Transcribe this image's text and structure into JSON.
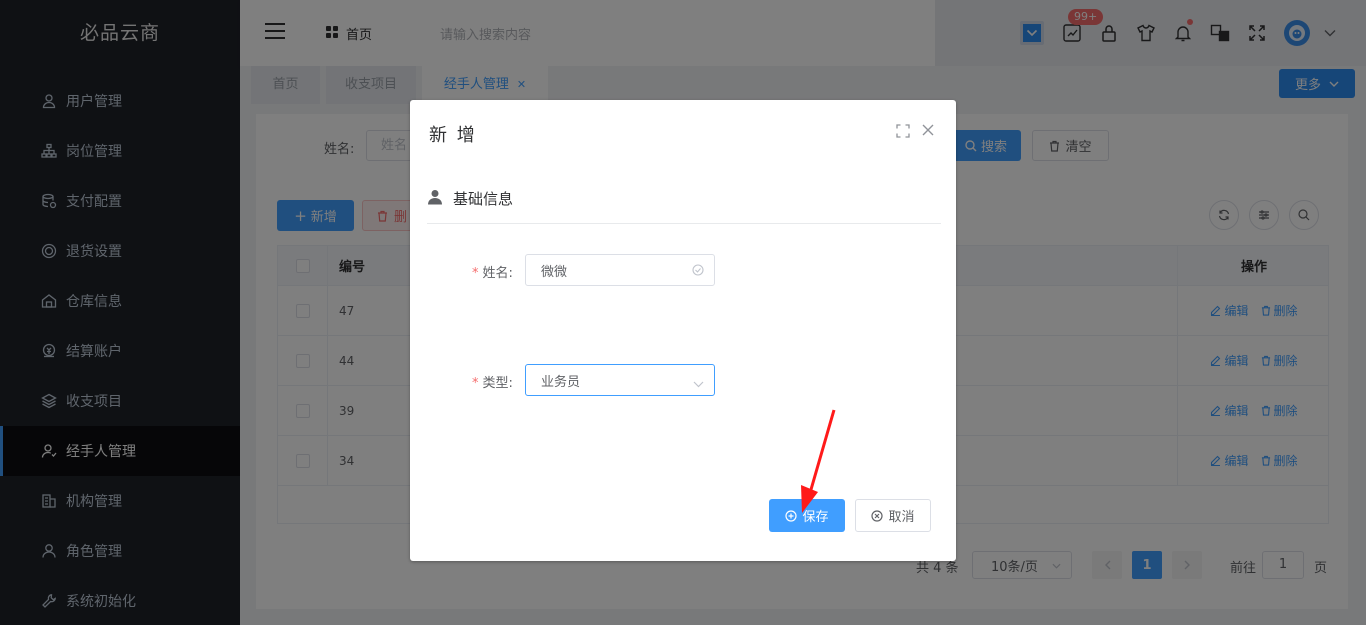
{
  "app": {
    "name": "必品云商"
  },
  "sidebar": {
    "items": [
      {
        "label": "用户管理",
        "icon": "user-icon",
        "active": false
      },
      {
        "label": "岗位管理",
        "icon": "org-icon",
        "active": false
      },
      {
        "label": "支付配置",
        "icon": "database-icon",
        "active": false
      },
      {
        "label": "退货设置",
        "icon": "return-icon",
        "active": false
      },
      {
        "label": "仓库信息",
        "icon": "warehouse-icon",
        "active": false
      },
      {
        "label": "结算账户",
        "icon": "account-icon",
        "active": false
      },
      {
        "label": "收支项目",
        "icon": "layers-icon",
        "active": false
      },
      {
        "label": "经手人管理",
        "icon": "handler-icon",
        "active": true
      },
      {
        "label": "机构管理",
        "icon": "building-icon",
        "active": false
      },
      {
        "label": "角色管理",
        "icon": "role-icon",
        "active": false
      },
      {
        "label": "系统初始化",
        "icon": "wrench-icon",
        "active": false
      }
    ]
  },
  "header": {
    "breadcrumb": "首页",
    "search_placeholder": "请输入搜索内容",
    "badge": "99+"
  },
  "tabs": {
    "items": [
      {
        "label": "首页",
        "active": false
      },
      {
        "label": "收支项目",
        "active": false
      },
      {
        "label": "经手人管理",
        "active": true
      }
    ],
    "more_label": "更多"
  },
  "filter": {
    "name_label": "姓名:",
    "name_placeholder": "姓名",
    "search_label": "搜索",
    "clear_label": "清空"
  },
  "toolbar": {
    "add_label": "新增",
    "delete_label": "删"
  },
  "table": {
    "columns": {
      "id": "编号",
      "actions": "操作"
    },
    "rows": [
      {
        "id": "47"
      },
      {
        "id": "44"
      },
      {
        "id": "39"
      },
      {
        "id": "34"
      }
    ],
    "edit_label": "编辑",
    "delete_label": "删除"
  },
  "pagination": {
    "total_text": "共 4 条",
    "page_size": "10条/页",
    "current_page": "1",
    "goto_label": "前往",
    "goto_value": "1",
    "page_suffix": "页"
  },
  "dialog": {
    "title": "新 增",
    "section_title": "基础信息",
    "name_label": "姓名:",
    "name_value": "微微",
    "type_label": "类型:",
    "type_value": "业务员",
    "save_label": "保存",
    "cancel_label": "取消"
  },
  "colors": {
    "primary": "#409eff",
    "sidebar_bg": "#1f2229",
    "danger": "#f56c6c",
    "arrow": "#ff1a1a"
  }
}
